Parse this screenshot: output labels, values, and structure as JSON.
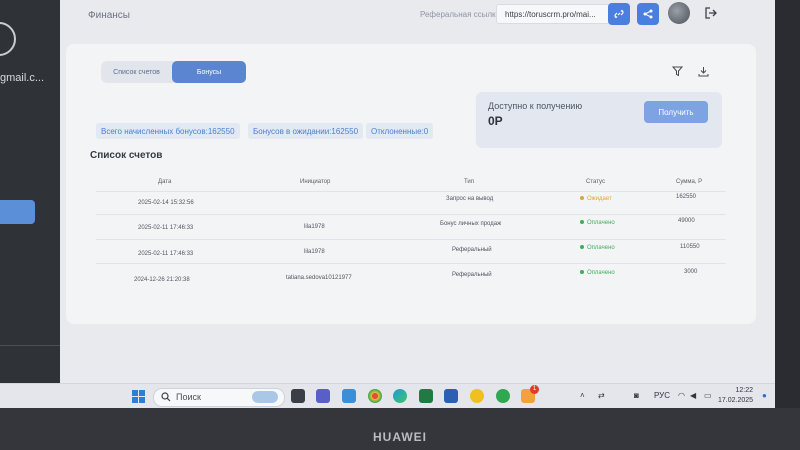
{
  "sidebar": {
    "email_fragment": "gmail.c..."
  },
  "header": {
    "title": "Финансы",
    "referral_label": "Реферальная ссылка",
    "referral_value": "https://toruscrm.pro/mai..."
  },
  "tabs": [
    {
      "label": "Список счетов"
    },
    {
      "label": "Бонусы"
    }
  ],
  "available": {
    "label": "Доступно к получению",
    "value": "0Р",
    "button": "Получить"
  },
  "stats": [
    "Всего начисленных бонусов:162550",
    "Бонусов в ожидании:162550",
    "Отклоненные:0"
  ],
  "table": {
    "title": "Список счетов",
    "headers": [
      "Дата",
      "Инициатор",
      "Тип",
      "Статус",
      "Сумма, Р"
    ],
    "rows": [
      {
        "date": "2025-02-14 15:32:56",
        "initiator": "",
        "type": "Запрос на вывод",
        "status": "Ожидает",
        "amount": "162550"
      },
      {
        "date": "2025-02-11 17:46:33",
        "initiator": "lila1978",
        "type": "Бонус личных продаж",
        "status": "Оплачено",
        "amount": "49000"
      },
      {
        "date": "2025-02-11 17:46:33",
        "initiator": "lila1978",
        "type": "Реферальный",
        "status": "Оплачено",
        "amount": "110550"
      },
      {
        "date": "2024-12-26 21:20:38",
        "initiator": "tatiana.sedova10121977",
        "type": "Реферальный",
        "status": "Оплачено",
        "amount": "3000"
      }
    ]
  },
  "colors": {
    "pending": "#e0a43a",
    "paid": "#3fae5a",
    "accent": "#4a7fe0"
  },
  "taskbar": {
    "search_placeholder": "Поиск",
    "language": "РУС",
    "time": "12:22",
    "date": "17.02.2025",
    "badge": "1"
  },
  "device_brand": "HUAWEI"
}
